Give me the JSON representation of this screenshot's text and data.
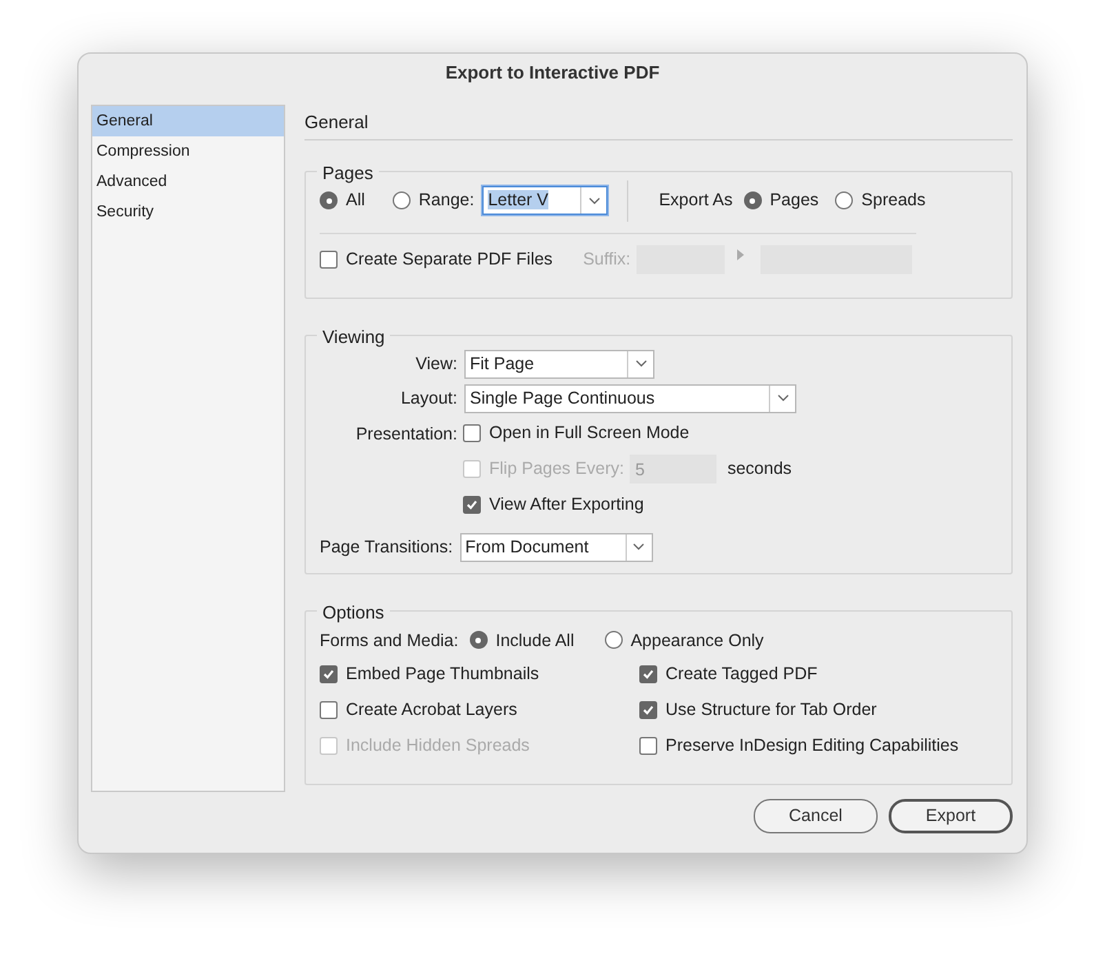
{
  "window": {
    "title": "Export to Interactive PDF"
  },
  "sidebar": {
    "items": [
      {
        "label": "General",
        "selected": true
      },
      {
        "label": "Compression",
        "selected": false
      },
      {
        "label": "Advanced",
        "selected": false
      },
      {
        "label": "Security",
        "selected": false
      }
    ]
  },
  "panel_title": "General",
  "pages": {
    "title": "Pages",
    "range_radios": [
      {
        "label": "All",
        "selected": true
      },
      {
        "label": "Range:",
        "selected": false
      }
    ],
    "range_value": "Letter V",
    "export_as_label": "Export As",
    "export_as_radios": [
      {
        "label": "Pages",
        "selected": true
      },
      {
        "label": "Spreads",
        "selected": false
      }
    ],
    "separate_files": {
      "label": "Create Separate PDF Files",
      "checked": false
    },
    "suffix_label": "Suffix:"
  },
  "viewing": {
    "title": "Viewing",
    "view": {
      "label": "View:",
      "value": "Fit Page"
    },
    "layout": {
      "label": "Layout:",
      "value": "Single Page Continuous"
    },
    "presentation_label": "Presentation:",
    "presentation": [
      {
        "label": "Open in Full Screen Mode",
        "checked": false,
        "disabled": false
      },
      {
        "label": "Flip Pages Every:",
        "checked": false,
        "disabled": true,
        "field_value": "5",
        "unit": "seconds"
      },
      {
        "label": "View After Exporting",
        "checked": true,
        "disabled": false
      }
    ],
    "page_transitions": {
      "label": "Page Transitions:",
      "value": "From Document"
    }
  },
  "options": {
    "title": "Options",
    "forms_label": "Forms and Media:",
    "forms_radios": [
      {
        "label": "Include All",
        "selected": true
      },
      {
        "label": "Appearance Only",
        "selected": false
      }
    ],
    "left_checks": [
      {
        "label": "Embed Page Thumbnails",
        "checked": true,
        "disabled": false
      },
      {
        "label": "Create Acrobat Layers",
        "checked": false,
        "disabled": false
      },
      {
        "label": "Include Hidden Spreads",
        "checked": false,
        "disabled": true
      }
    ],
    "right_checks": [
      {
        "label": "Create Tagged PDF",
        "checked": true,
        "disabled": false
      },
      {
        "label": "Use Structure for Tab Order",
        "checked": true,
        "disabled": false
      },
      {
        "label": "Preserve InDesign Editing Capabilities",
        "checked": false,
        "disabled": false
      }
    ]
  },
  "buttons": [
    {
      "label": "Cancel",
      "default": false
    },
    {
      "label": "Export",
      "default": true
    }
  ]
}
